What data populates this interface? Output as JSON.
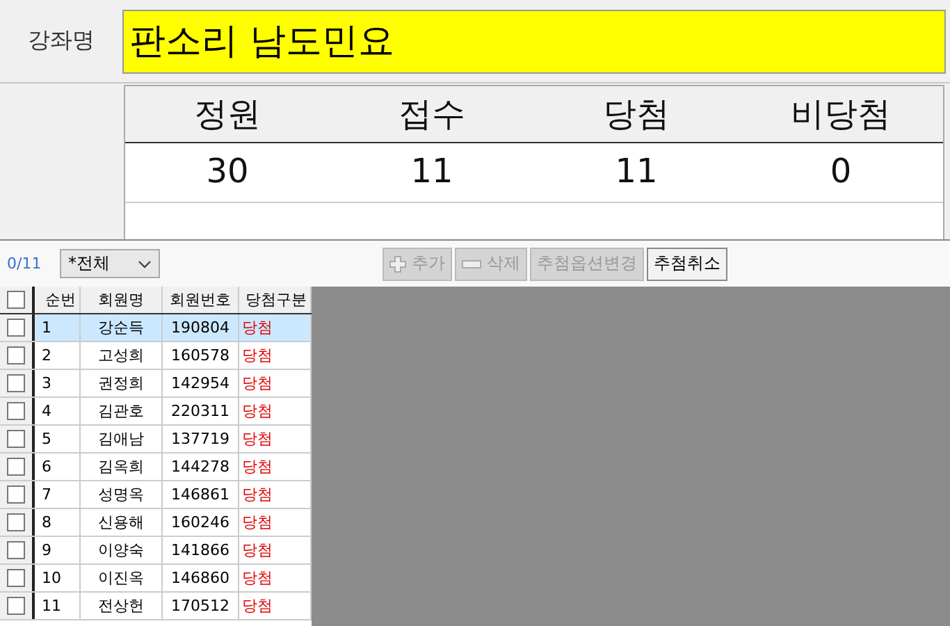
{
  "course": {
    "label": "강좌명",
    "value": "판소리 남도민요"
  },
  "stats": {
    "columns": [
      "정원",
      "접수",
      "당첨",
      "비당첨"
    ],
    "values": [
      "30",
      "11",
      "11",
      "0"
    ]
  },
  "toolbar": {
    "count": "0/11",
    "filter": "*전체",
    "buttons": [
      {
        "label": "추가",
        "disabled": true
      },
      {
        "label": "삭제",
        "disabled": true
      },
      {
        "label": "추첨옵션변경",
        "disabled": true
      },
      {
        "label": "추첨취소",
        "disabled": false
      }
    ]
  },
  "table": {
    "header_checked": false,
    "columns": [
      "순번",
      "회원명",
      "회원번호",
      "당첨구분"
    ],
    "rows": [
      {
        "no": "1",
        "name": "강순득",
        "id": "190804",
        "result": "당첨",
        "checked": false,
        "selected": true
      },
      {
        "no": "2",
        "name": "고성희",
        "id": "160578",
        "result": "당첨",
        "checked": false,
        "selected": false
      },
      {
        "no": "3",
        "name": "권정희",
        "id": "142954",
        "result": "당첨",
        "checked": false,
        "selected": false
      },
      {
        "no": "4",
        "name": "김관호",
        "id": "220311",
        "result": "당첨",
        "checked": false,
        "selected": false
      },
      {
        "no": "5",
        "name": "김애남",
        "id": "137719",
        "result": "당첨",
        "checked": false,
        "selected": false
      },
      {
        "no": "6",
        "name": "김옥희",
        "id": "144278",
        "result": "당첨",
        "checked": false,
        "selected": false
      },
      {
        "no": "7",
        "name": "성명옥",
        "id": "146861",
        "result": "당첨",
        "checked": false,
        "selected": false
      },
      {
        "no": "8",
        "name": "신용해",
        "id": "160246",
        "result": "당첨",
        "checked": false,
        "selected": false
      },
      {
        "no": "9",
        "name": "이양숙",
        "id": "141866",
        "result": "당첨",
        "checked": false,
        "selected": false
      },
      {
        "no": "10",
        "name": "이진옥",
        "id": "146860",
        "result": "당첨",
        "checked": false,
        "selected": false
      },
      {
        "no": "11",
        "name": "전상헌",
        "id": "170512",
        "result": "당첨",
        "checked": false,
        "selected": false
      }
    ]
  }
}
